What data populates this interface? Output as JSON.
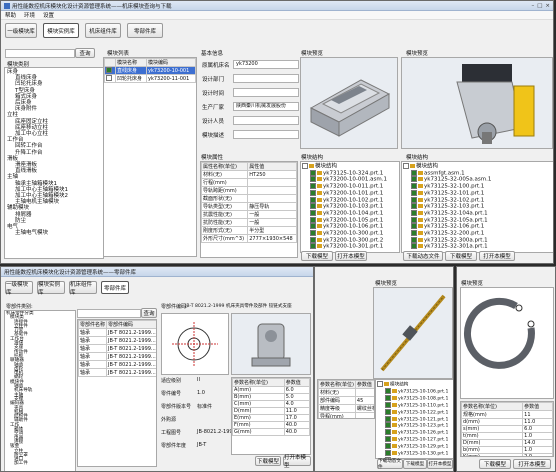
{
  "main_window": {
    "title": "用性能数控机床模块化设计资源管理系统——机床模块查询与下载",
    "menu": [
      "帮助",
      "环境",
      "设置"
    ],
    "toolbar": [
      "一级模块库",
      "模块实例库",
      "机床组件库",
      "零部件库"
    ],
    "search": {
      "value": "",
      "button": "查询"
    },
    "tree_label": "模块类别",
    "tree": [
      "床身",
      "直线床身",
      "凹轮托床身",
      "T型床身",
      "箱式床身",
      "后床身",
      "床身附件",
      "立柱",
      "底座固定立柱",
      "底座移动立柱",
      "加工中心立柱",
      "工作台",
      "回转工作台",
      "升降工作台",
      "滑板",
      "滑座滑板",
      "直线滑板",
      "主轴",
      "轴承主轴箱模块1",
      "加工中心主轴箱模块1",
      "加工中心主轴箱模块2",
      "主轴电机主轴模块",
      "辅助模块",
      "排屑器",
      "防尘",
      "电气",
      "主轴电气模块"
    ],
    "module_list": {
      "header": "模块列表",
      "cols": [
        "模块名称",
        "模块编码"
      ],
      "rows": [
        [
          "直线床身",
          "yk73200-10-001"
        ],
        [
          "凹轮托床身",
          "yk73200-11-001"
        ]
      ]
    },
    "basic_info": {
      "header": "基本信息",
      "fields": [
        [
          "原属机床名",
          "yk73200"
        ],
        [
          "设计部门",
          ""
        ],
        [
          "设计时间",
          ""
        ],
        [
          "生产厂家",
          "陕西秦川机械发展股份"
        ],
        [
          "设计人员",
          ""
        ],
        [
          "模块描述",
          ""
        ]
      ]
    },
    "attrs": {
      "header": "模块属性",
      "cols": [
        "属性名称(单位)",
        "属性值"
      ],
      "rows": [
        [
          "材料(无)",
          "HT250"
        ],
        [
          "行程(mm)",
          ""
        ],
        [
          "导轨跨距(mm)",
          ""
        ],
        [
          "截面形状(无)",
          ""
        ],
        [
          "导轨类型(无)",
          "静压导轨"
        ],
        [
          "抗震性能(无)",
          "一般"
        ],
        [
          "抗防性能(无)",
          "一般"
        ],
        [
          "刚度形式(无)",
          "半分型"
        ],
        [
          "外形尺寸(mm^3)",
          "2777×1930×548"
        ]
      ]
    },
    "left_model": {
      "header": "模块预览",
      "buttons": [
        "下载模型",
        "打开本模型"
      ],
      "tree_header": "模块结构",
      "tree": [
        "模块结构",
        "yk73125-10-324.prt.1",
        "yk73200-10-001.asm.1",
        "yk73200-10-011.prt.1",
        "yk73200-10-101.prt.1",
        "yk73200-10-102.prt.1",
        "yk73200-10-103.prt.1",
        "yk73200-10-104.prt.1",
        "yk73200-10-105.prt.1",
        "yk73200-10-106.prt.1",
        "yk73200-10-300.prt.1",
        "yk73200-10-300.prt.2",
        "yk73200-10-301.prt.1"
      ]
    },
    "right_model": {
      "header": "模块预览",
      "buttons": [
        "下载动态文件",
        "下载模型",
        "打开本模型"
      ],
      "tree_header": "模块结构",
      "tree": [
        "模块结构",
        "assmfgt.asm.1",
        "yk73125-32-005a.asm.1",
        "yk73125-32-100.prt.1",
        "yk73125-32-101.prt.1",
        "yk73125-32-102.prt.1",
        "yk73125-32-103.prt.1",
        "yk73125-32-104a.prt.1",
        "yk73125-32-105a.prt.1",
        "yk73125-32-106.prt.1",
        "yk73125-32-200.prt.1",
        "yk73125-32-300a.prt.1",
        "yk73125-32-301a.prt.1"
      ]
    }
  },
  "second_window": {
    "title": "用性能数控机床模块化设计资源管理系统——零部件库",
    "toolbar": [
      "一级模块库",
      "模块实例库",
      "机床组件库",
      "零部件库"
    ],
    "tree_label": "零部件类别:",
    "tree": [
      "机床零件分类",
      "模块类",
      "连接件",
      "立柱件",
      "刀架",
      "基础件",
      "工作台",
      "滑块",
      "支座",
      "传动件",
      "托板",
      "联轴器",
      "轴承",
      "齿轮",
      "电机",
      "蜗轮",
      "模块件",
      "轴承",
      "机床导轨",
      "主轴",
      "支撑",
      "编码器",
      "夹具",
      "机械",
      "结构件",
      "辅助件",
      "工作",
      "箱体",
      "空调",
      "电器",
      "连接",
      "钣金",
      "立柱",
      "防尘罩",
      "进口",
      "加工件"
    ],
    "search_button": "查询",
    "list_cols": [
      "零部件名称",
      "零部件编码"
    ],
    "list_rows": [
      [
        "轴承",
        "JB-T 8021.2-1999..."
      ],
      [
        "轴承",
        "JB-T 8021.2-1999..."
      ],
      [
        "轴承",
        "JB-T 8021.2-1999..."
      ],
      [
        "轴承",
        "JB-T 8021.2-1999..."
      ],
      [
        "轴承",
        "JB-T 8021.2-1999..."
      ],
      [
        "轴承",
        "JB-T 8021.2-1999..."
      ]
    ],
    "code_label": "零部件编码:",
    "code_value": "JB-T 8021.2-1999 机床夹具零件及部件 铰链式支座",
    "info": [
      [
        "适应级别",
        "II"
      ],
      [
        "零件编号",
        "1.0"
      ],
      [
        "零部件版本号",
        "标准件"
      ],
      [
        "外购源",
        ""
      ],
      [
        "工程图号",
        "JB-8021.2-1999"
      ],
      [
        "零部件年度",
        "JB-T"
      ]
    ],
    "params_cols": [
      "参数名称(单位)",
      "参数值"
    ],
    "params": [
      [
        "A(mm)",
        "6.0"
      ],
      [
        "B(mm)",
        "5.0"
      ],
      [
        "C(mm)",
        "4.0"
      ],
      [
        "D(mm)",
        "11.0"
      ],
      [
        "E(mm)",
        "17.0"
      ],
      [
        "F(mm)",
        "40.0"
      ],
      [
        "G(mm)",
        "40.0"
      ]
    ],
    "buttons": [
      "下载模型",
      "打开本模型"
    ]
  },
  "third_window": {
    "header": "模块预览",
    "params_cols": [
      "参数名称(单位)",
      "参数值"
    ],
    "params": [
      [
        "材料(无)",
        ""
      ],
      [
        "部件编码",
        "45"
      ],
      [
        "精度等级",
        "螺纹丝杠"
      ],
      [
        "导程(mm)",
        ""
      ],
      [
        "",
        ""
      ]
    ],
    "tree": [
      "模块结构",
      "yk73125-10-106.prt.1",
      "yk73125-10-108.prt.1",
      "yk73125-10-110.prt.1",
      "yk73125-10-122.prt.1",
      "yk73125-10-121.prt.1",
      "yk73125-10-123.prt.1",
      "yk73125-10-126.prt.1",
      "yk73125-10-127.prt.1",
      "yk73125-10-129.prt.1",
      "yk73125-10-130.prt.1",
      "yk73125-10-140.prt.1",
      "yk73125-10-143.prt.1"
    ],
    "buttons": [
      "下载动态文件",
      "下载模型",
      "打开本模型"
    ]
  },
  "fourth_window": {
    "header": "模块预览",
    "params_cols": [
      "参数名称(单位)",
      "参数值"
    ],
    "params": [
      [
        "规格(mm)",
        "11"
      ],
      [
        "d(mm)",
        "11.0"
      ],
      [
        "s(mm)",
        "6.0"
      ],
      [
        "t(mm)",
        "1.0"
      ],
      [
        "D(mm)",
        "14.0"
      ],
      [
        "b(mm)",
        "1.0"
      ],
      [
        "K(mm)",
        "2.0"
      ],
      [
        "质量",
        "0.5"
      ]
    ],
    "buttons": [
      "下载模型",
      "打开本模型"
    ]
  }
}
